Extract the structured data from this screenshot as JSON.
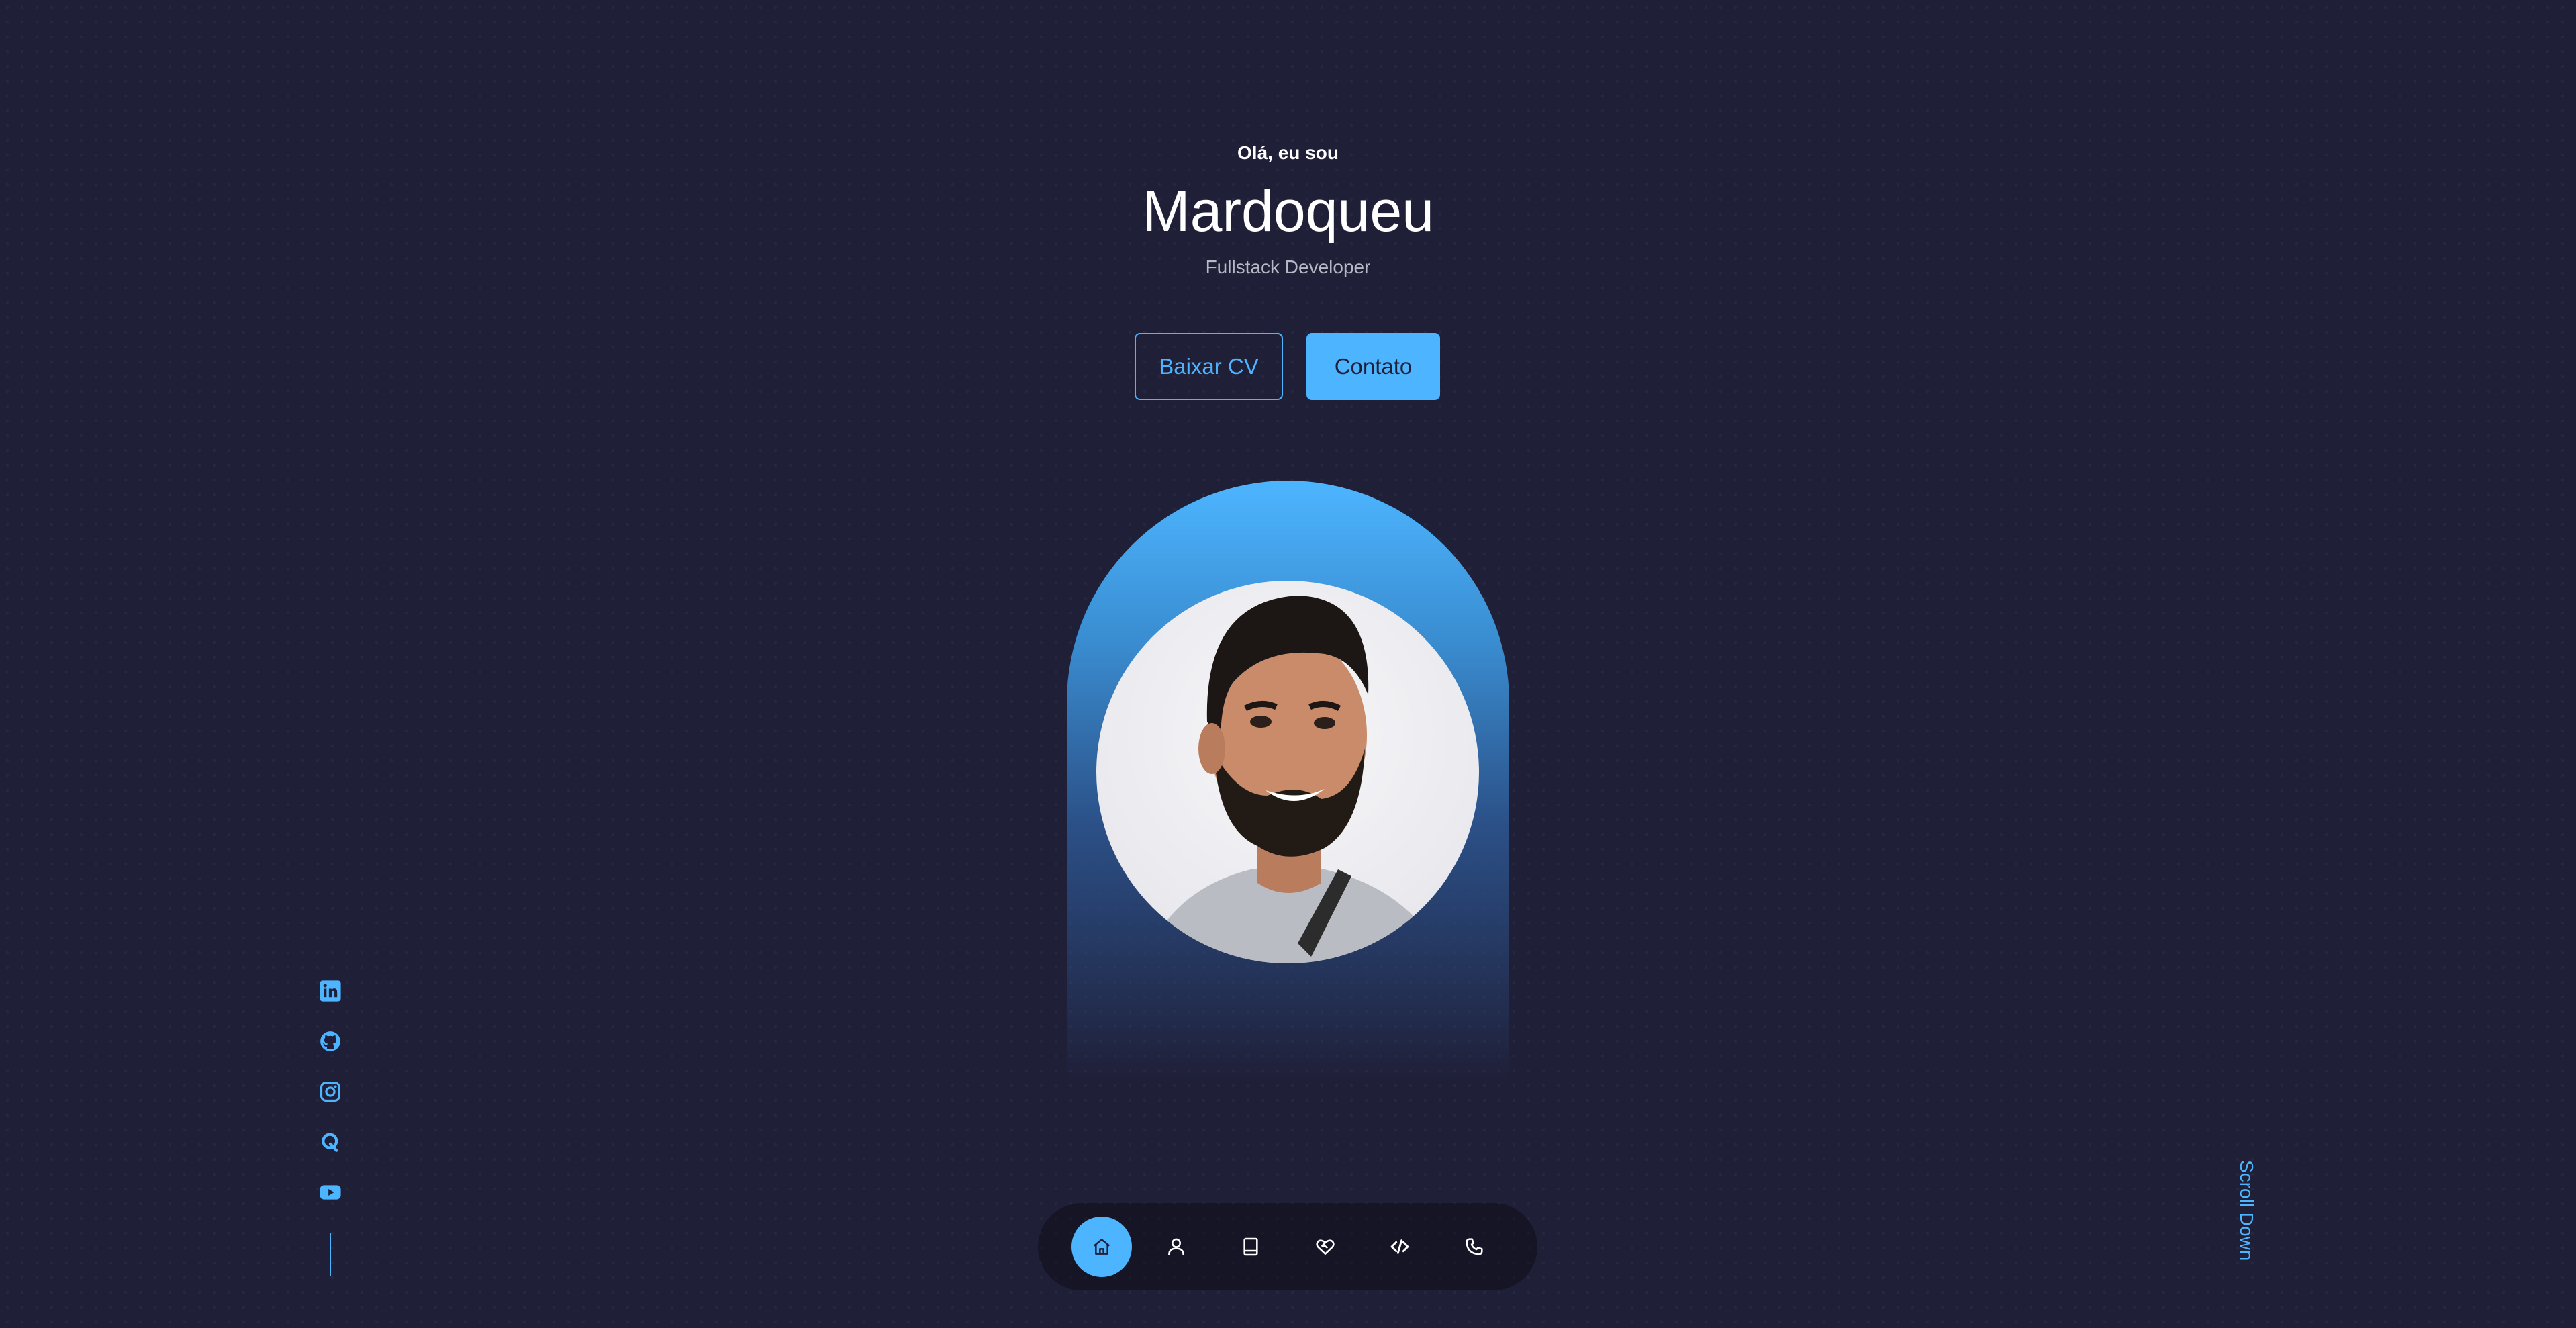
{
  "header": {
    "greeting": "Olá, eu sou",
    "name": "Mardoqueu",
    "role": "Fullstack Developer"
  },
  "cta": {
    "download_cv": "Baixar CV",
    "contact": "Contato"
  },
  "social": [
    {
      "icon": "linkedin-icon"
    },
    {
      "icon": "github-icon"
    },
    {
      "icon": "instagram-icon"
    },
    {
      "icon": "quora-icon"
    },
    {
      "icon": "youtube-icon"
    }
  ],
  "scroll_label": "Scroll Down",
  "nav": [
    {
      "icon": "home-icon",
      "active": true
    },
    {
      "icon": "user-icon",
      "active": false
    },
    {
      "icon": "book-icon",
      "active": false
    },
    {
      "icon": "heart-handshake-icon",
      "active": false
    },
    {
      "icon": "code-icon",
      "active": false
    },
    {
      "icon": "phone-icon",
      "active": false
    }
  ],
  "colors": {
    "background": "#1f1f38",
    "accent": "#4db5ff",
    "muted_text": "#b7b9c6",
    "dock": "#121223"
  }
}
